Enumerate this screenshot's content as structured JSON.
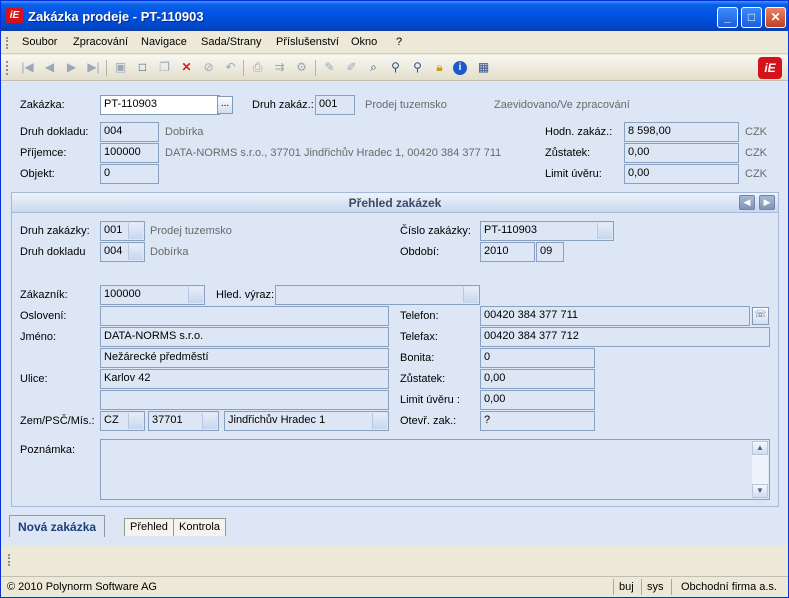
{
  "window": {
    "title": "Zakázka prodeje - PT-110903",
    "minimize": "_",
    "maximize": "□",
    "close": "✕"
  },
  "menu": [
    "Soubor",
    "Zpracování",
    "Navigace",
    "Sada/Strany",
    "Příslušenství",
    "Okno",
    "?"
  ],
  "toolbar_icons": [
    "first-icon",
    "prev-icon",
    "next-icon",
    "last-icon",
    "save-icon",
    "new-icon",
    "copy-icon",
    "delete-icon",
    "cancel-icon",
    "undo-icon",
    "print-icon",
    "export-icon",
    "settings-icon",
    "edit-icon",
    "pen-icon",
    "search-text-icon",
    "find-icon",
    "find-user-icon",
    "lock-icon",
    "info-icon",
    "calculator-icon"
  ],
  "logo": "iE",
  "header": {
    "zakazka_label": "Zakázka:",
    "zakazka_value": "PT-110903",
    "druh_zakaz_label": "Druh zakáz.:",
    "druh_zakaz_value": "001",
    "druh_zakaz_text": "Prodej tuzemsko",
    "status": "Zaevidovano/Ve zpracování",
    "druh_dokladu_label": "Druh dokladu:",
    "druh_dokladu_value": "004",
    "druh_dokladu_text": "Dobírka",
    "prijemce_label": "Příjemce:",
    "prijemce_value": "100000",
    "prijemce_text": "DATA-NORMS s.r.o., 37701 Jindřichův Hradec 1, 00420 384 377 711",
    "objekt_label": "Objekt:",
    "objekt_value": "0",
    "hodn_label": "Hodn. zakáz.:",
    "hodn_value": "8 598,00",
    "zustatek_label": "Zůstatek:",
    "zustatek_value": "0,00",
    "limit_label": "Limit úvěru:",
    "limit_value": "0,00",
    "currency": "CZK"
  },
  "panel": {
    "title": "Přehled zakázek",
    "druh_zakazky_label": "Druh zakázky:",
    "druh_zakazky_value": "001",
    "druh_zakazky_text": "Prodej tuzemsko",
    "druh_dokladu_label": "Druh dokladu",
    "druh_dokladu_value": "004",
    "druh_dokladu_text": "Dobírka",
    "cislo_label": "Číslo zakázky:",
    "cislo_value": "PT-110903",
    "obdobi_label": "Období:",
    "obdobi_year": "2010",
    "obdobi_month": "09",
    "zakaznik_label": "Zákazník:",
    "zakaznik_value": "100000",
    "hled_label": "Hled. výraz:",
    "hled_value": "",
    "osloveni_label": "Oslovení:",
    "osloveni_value": "",
    "jmeno_label": "Jméno:",
    "jmeno_value": "DATA-NORMS s.r.o.",
    "jmeno2_value": "Nežárecké předměstí",
    "ulice_label": "Ulice:",
    "ulice_value": "Karlov 42",
    "ulice2_value": "",
    "zem_label": "Zem/PSČ/Mís.:",
    "zem_value": "CZ",
    "psc_value": "37701",
    "misto_value": "Jindřichův Hradec 1",
    "telefon_label": "Telefon:",
    "telefon_value": "00420 384 377 711",
    "telefax_label": "Telefax:",
    "telefax_value": "00420 384 377 712",
    "bonita_label": "Bonita:",
    "bonita_value": "0",
    "zustatek_label": "Zůstatek:",
    "zustatek_value": "0,00",
    "limit_label": "Limit úvěru :",
    "limit_value": "0,00",
    "otevr_label": "Otevř. zak.:",
    "otevr_value": "?",
    "poznamka_label": "Poznámka:",
    "poznamka_value": ""
  },
  "tabs": [
    "Nová zakázka",
    "Přehled",
    "Kontrola"
  ],
  "status": {
    "copyright": "© 2010 Polynorm Software AG",
    "user": "buj",
    "sys": "sys",
    "company": "Obchodní firma a.s."
  }
}
